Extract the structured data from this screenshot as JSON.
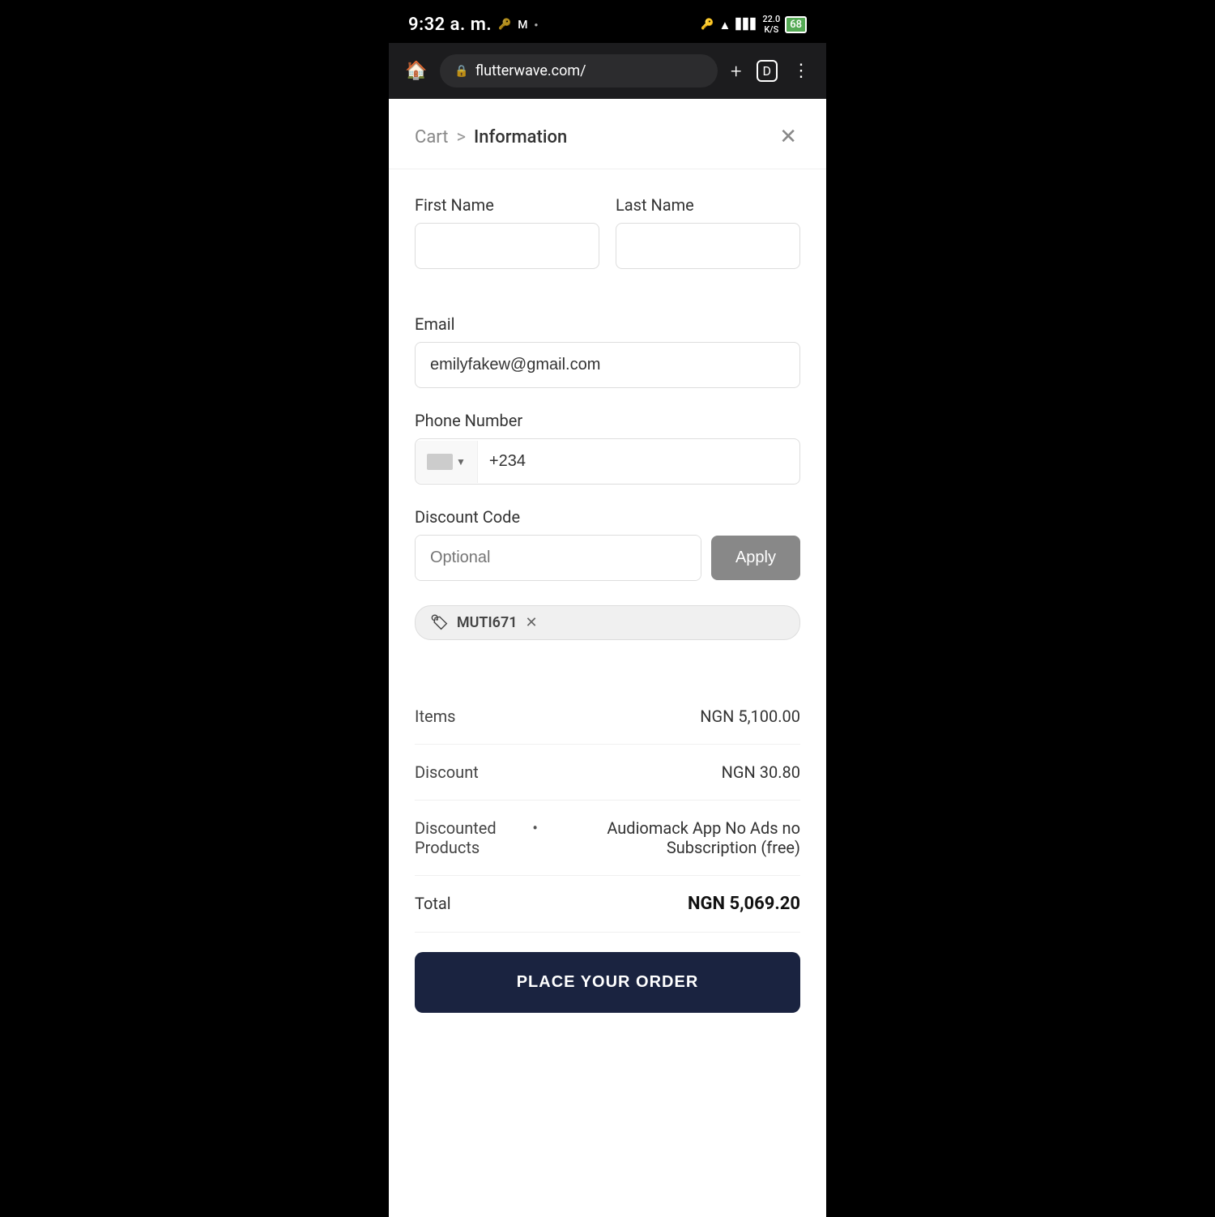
{
  "statusBar": {
    "time": "9:32 a. m.",
    "icons": [
      "key",
      "mail",
      "dot",
      "wifi",
      "signal",
      "22.0",
      "68"
    ]
  },
  "browser": {
    "url": "flutterwave.com/",
    "homeIcon": "🏠",
    "addTabIcon": "+",
    "tabIcon": "D",
    "menuIcon": "⋮"
  },
  "breadcrumb": {
    "cart": "Cart",
    "separator": ">",
    "current": "Information"
  },
  "form": {
    "firstNameLabel": "First Name",
    "firstNameValue": "",
    "firstNamePlaceholder": "",
    "lastNameLabel": "Last Name",
    "lastNameValue": "",
    "lastNamePlaceholder": "",
    "emailLabel": "Email",
    "emailValue": "emilyfakew@gmail.com",
    "phoneLabel": "Phone Number",
    "phoneCode": "+234",
    "discountLabel": "Discount Code",
    "discountPlaceholder": "Optional",
    "discountValue": "",
    "applyBtn": "Apply",
    "appliedCode": "MUTI671"
  },
  "summary": {
    "itemsLabel": "Items",
    "itemsValue": "NGN 5,100.00",
    "discountLabel": "Discount",
    "discountValue": "NGN 30.80",
    "discountedProductsLabel": "Discounted Products",
    "discountedProducts": [
      "Audiomack App No Ads no Subscription (free)"
    ],
    "totalLabel": "Total",
    "totalValue": "NGN 5,069.20"
  },
  "cta": {
    "placeOrderLabel": "PLACE YOUR ORDER"
  }
}
